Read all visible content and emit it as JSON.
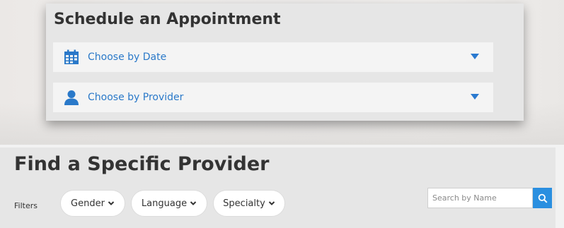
{
  "schedule": {
    "title": "Schedule an Appointment",
    "options": [
      {
        "label": "Choose by Date",
        "icon": "calendar-icon"
      },
      {
        "label": "Choose by Provider",
        "icon": "person-icon"
      }
    ]
  },
  "provider_search": {
    "title": "Find a Specific Provider",
    "filters_label": "Filters",
    "filters": [
      {
        "label": "Gender"
      },
      {
        "label": "Language"
      },
      {
        "label": "Specialty"
      }
    ],
    "search_placeholder": "Search by Name",
    "search_value": ""
  },
  "colors": {
    "accent_blue": "#2a79c9",
    "caret_blue": "#2a7ad0",
    "search_button_blue": "#2a8fe0",
    "panel_gray": "#e6e6e6",
    "row_gray": "#f4f4f4",
    "heading_text": "#333333"
  },
  "icons": [
    "calendar-icon",
    "person-icon",
    "chevron-down-icon",
    "caret-down-icon",
    "search-icon"
  ]
}
